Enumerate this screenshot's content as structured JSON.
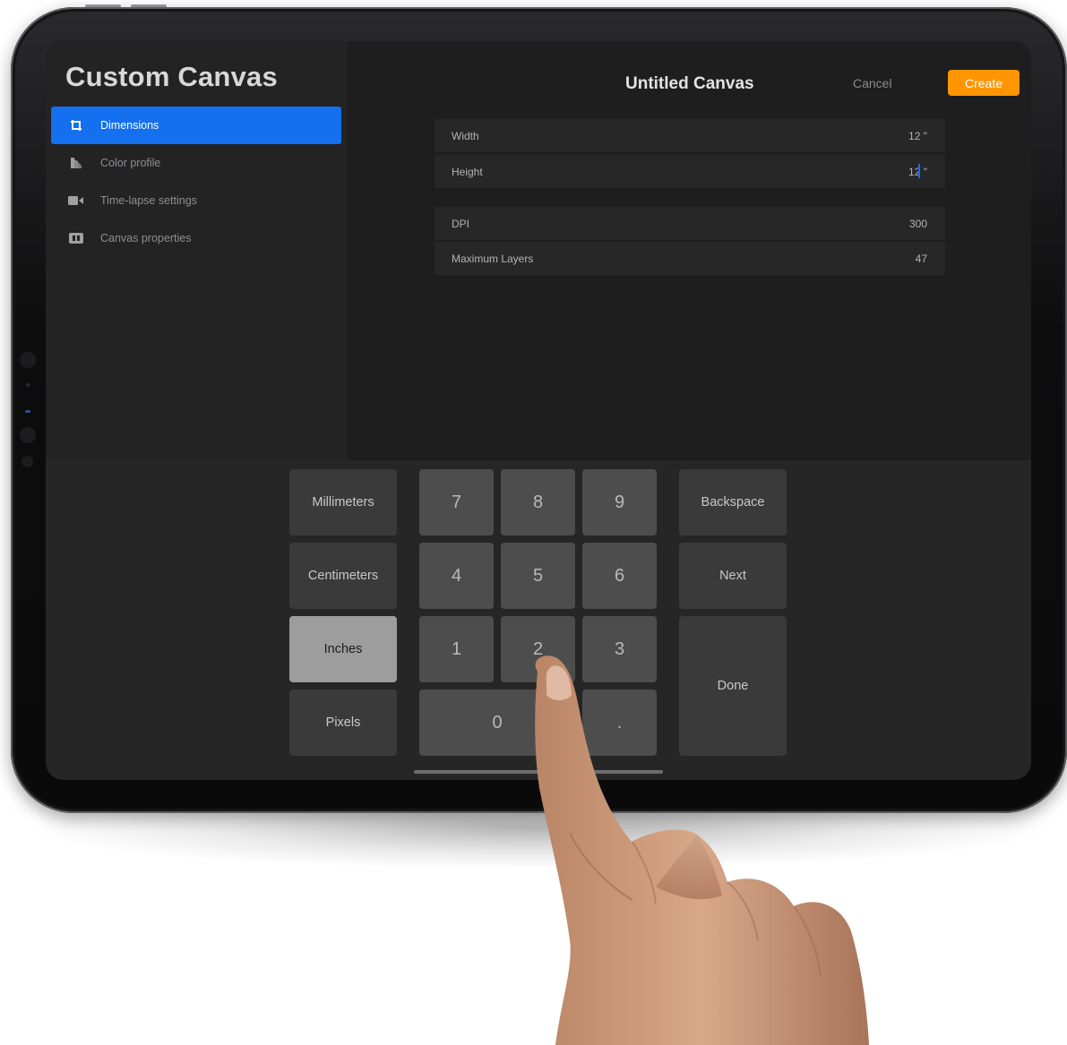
{
  "sidebar": {
    "title": "Custom Canvas",
    "items": [
      {
        "label": "Dimensions",
        "icon": "crop-icon",
        "active": true
      },
      {
        "label": "Color profile",
        "icon": "color-profile-icon",
        "active": false
      },
      {
        "label": "Time-lapse settings",
        "icon": "video-camera-icon",
        "active": false
      },
      {
        "label": "Canvas properties",
        "icon": "canvas-properties-icon",
        "active": false
      }
    ]
  },
  "header": {
    "title": "Untitled Canvas",
    "cancel_label": "Cancel",
    "create_label": "Create"
  },
  "fields": [
    {
      "label": "Width",
      "value": "12 \""
    },
    {
      "label": "Height",
      "value": "12 \""
    },
    {
      "label": "DPI",
      "value": "300"
    },
    {
      "label": "Maximum Layers",
      "value": "47"
    }
  ],
  "keyboard": {
    "units": [
      "Millimeters",
      "Centimeters",
      "Inches",
      "Pixels"
    ],
    "selected_unit": "Inches",
    "digits": [
      "7",
      "8",
      "9",
      "4",
      "5",
      "6",
      "1",
      "2",
      "3",
      "0",
      "."
    ],
    "backspace_label": "Backspace",
    "next_label": "Next",
    "done_label": "Done"
  },
  "colors": {
    "accent_blue": "#1570ef",
    "create_orange": "#ff9500",
    "background": "#1e1e1e"
  }
}
